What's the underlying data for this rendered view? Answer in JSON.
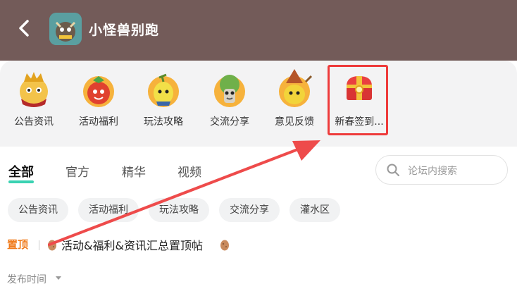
{
  "header": {
    "title": "小怪兽别跑",
    "bg_color": "#735b59"
  },
  "categories": [
    {
      "label": "公告资讯",
      "icon": "king-monster-icon"
    },
    {
      "label": "活动福利",
      "icon": "tomato-monster-icon"
    },
    {
      "label": "玩法攻略",
      "icon": "pear-monster-icon"
    },
    {
      "label": "交流分享",
      "icon": "tree-monster-icon"
    },
    {
      "label": "意见反馈",
      "icon": "wizard-monster-icon"
    },
    {
      "label": "新春签到...",
      "icon": "treasure-chest-icon"
    }
  ],
  "tabs": [
    {
      "label": "全部",
      "active": true
    },
    {
      "label": "官方",
      "active": false
    },
    {
      "label": "精华",
      "active": false
    },
    {
      "label": "视频",
      "active": false
    }
  ],
  "search": {
    "placeholder": "论坛内搜索"
  },
  "chips": [
    "公告资讯",
    "活动福利",
    "玩法攻略",
    "交流分享",
    "灌水区"
  ],
  "pinned": {
    "tag": "置顶",
    "text": "活动&福利&资讯汇总置顶帖"
  },
  "sort": {
    "label": "发布时间"
  },
  "annotation": {
    "highlight_color": "#ee3b3b",
    "accent": "#3ad2b2",
    "pin_color": "#f07a1a"
  }
}
